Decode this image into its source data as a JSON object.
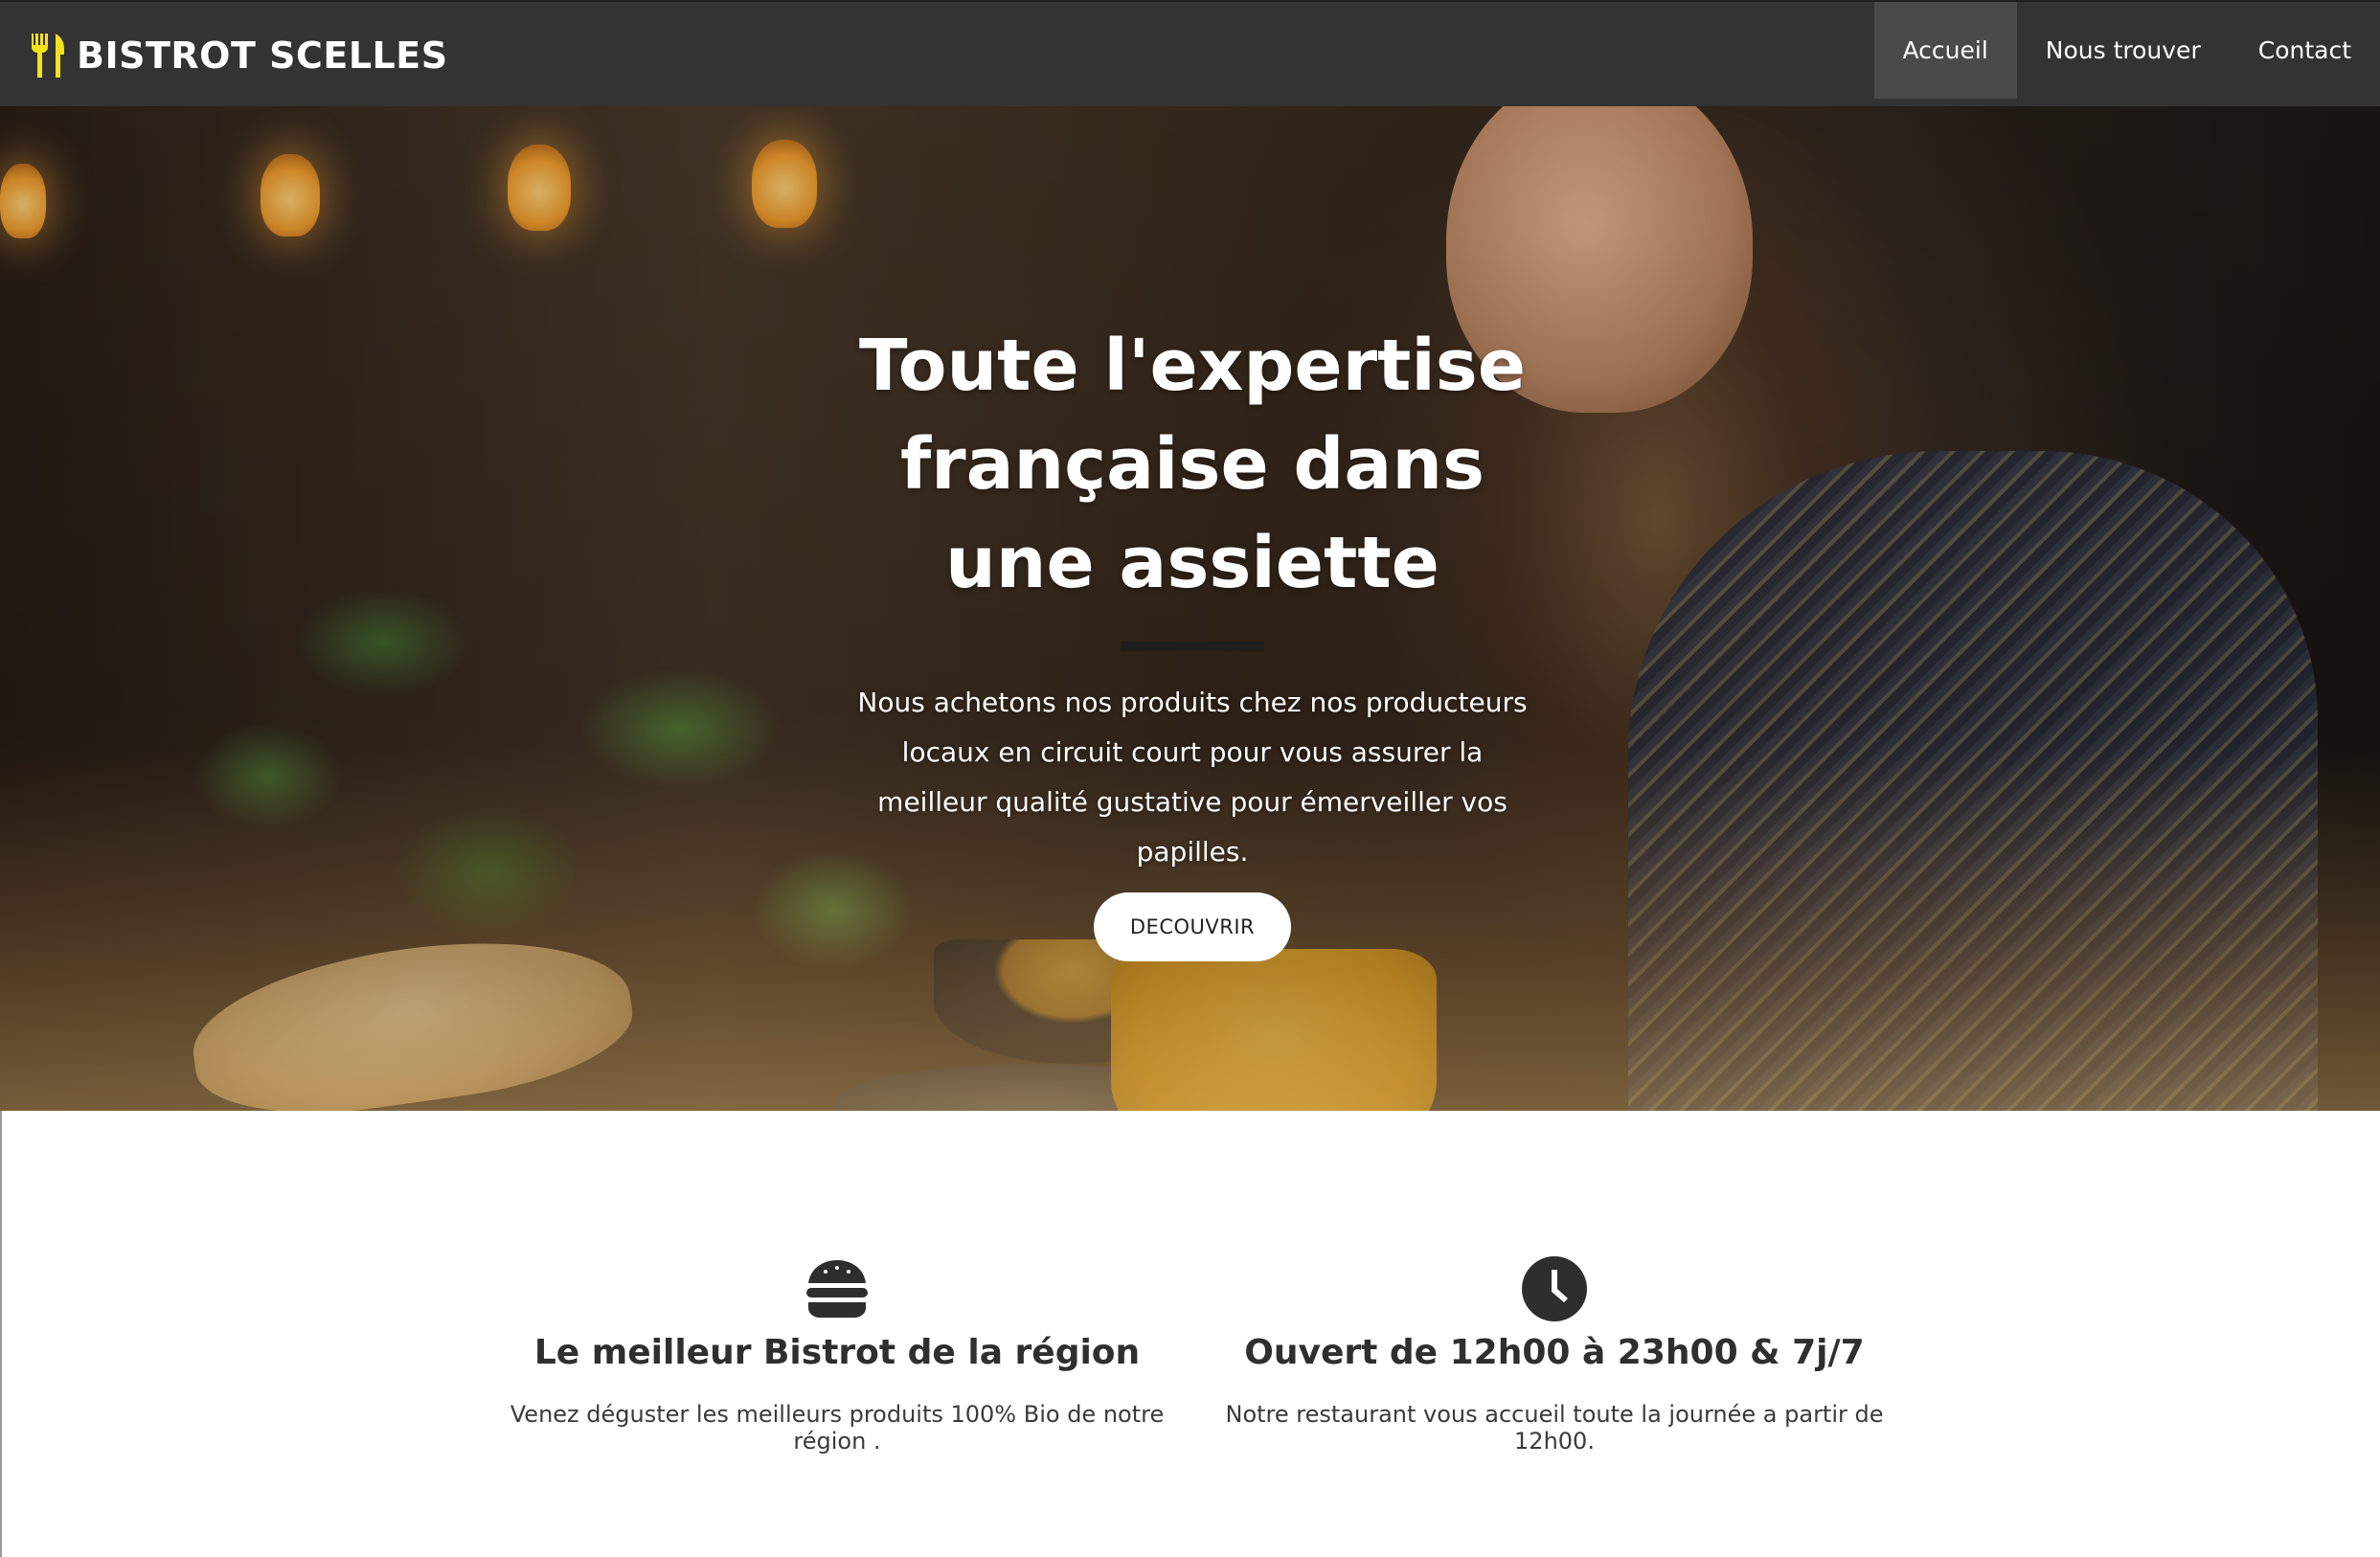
{
  "brand": {
    "name": "BISTROT SCELLES",
    "icon": "utensils-icon",
    "accent_color": "#f5e21a"
  },
  "nav": {
    "items": [
      {
        "label": "Accueil",
        "active": true
      },
      {
        "label": "Nous trouver",
        "active": false
      },
      {
        "label": "Contact",
        "active": false
      }
    ]
  },
  "hero": {
    "title_lines": [
      "Toute l'expertise",
      "française dans",
      "une assiette"
    ],
    "description": "Nous achetons nos produits chez nos producteurs locaux en circuit court pour vous assurer la meilleur qualité gustative pour émerveiller vos papilles.",
    "button_label": "DECOUVRIR"
  },
  "features": [
    {
      "icon": "burger-icon",
      "title": "Le meilleur Bistrot de la région",
      "description": "Venez déguster les meilleurs produits 100% Bio de notre région ."
    },
    {
      "icon": "clock-icon",
      "title": "Ouvert de 12h00 à 23h00 & 7j/7",
      "description": "Notre restaurant vous accueil toute la journée a partir de 12h00."
    }
  ]
}
